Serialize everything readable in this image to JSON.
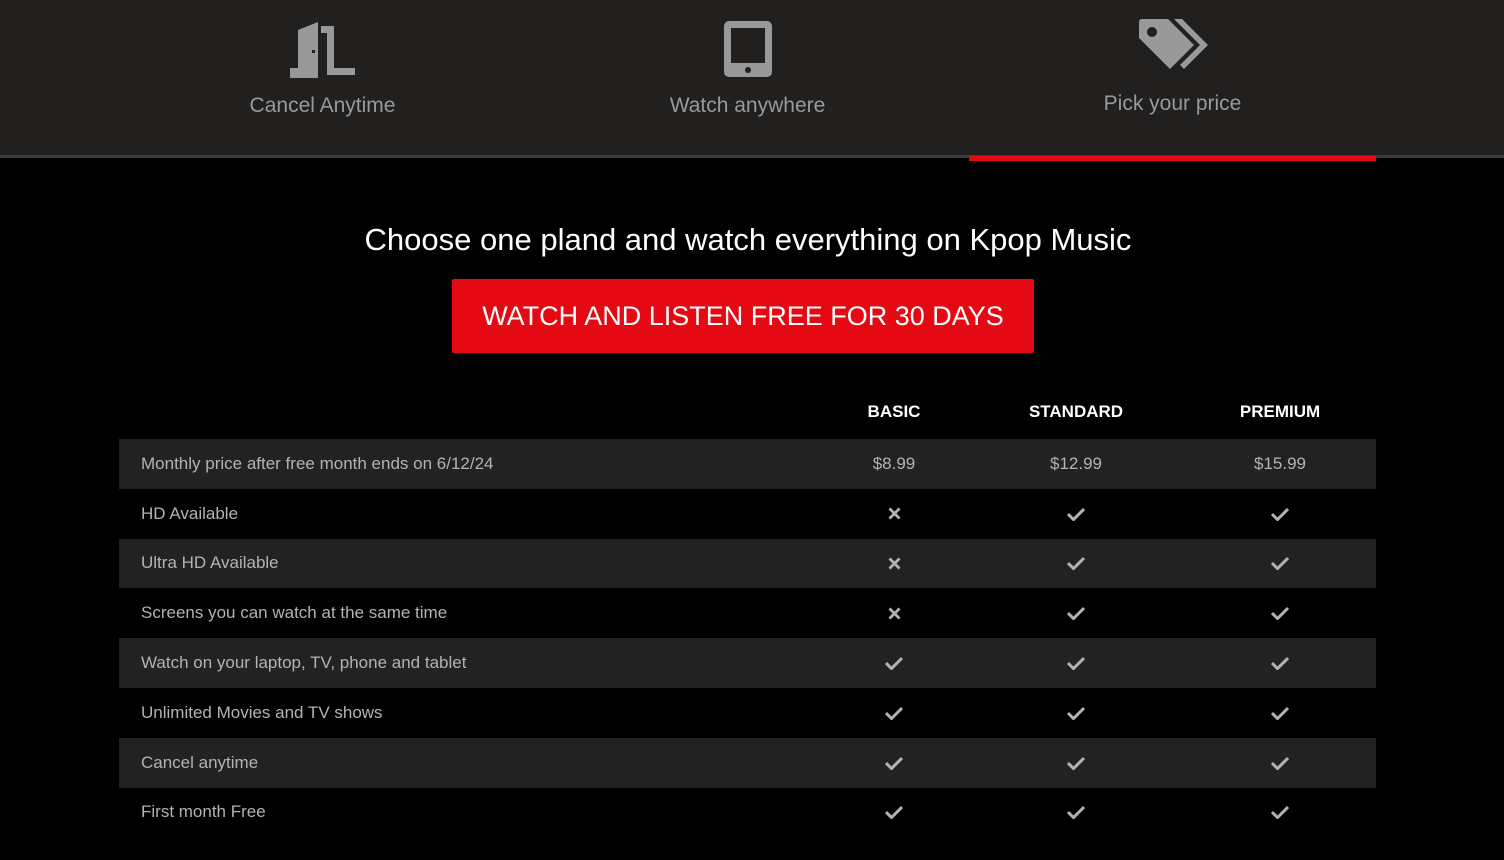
{
  "tabs": [
    {
      "label": "Cancel Anytime",
      "icon": "door-icon",
      "active": false
    },
    {
      "label": "Watch anywhere",
      "icon": "tablet-icon",
      "active": false
    },
    {
      "label": "Pick your price",
      "icon": "price-tags-icon",
      "active": true
    }
  ],
  "heading": "Choose one pland and watch everything on Kpop Music",
  "cta_label": "WATCH AND LISTEN FREE FOR 30 DAYS",
  "plans": [
    "BASIC",
    "STANDARD",
    "PREMIUM"
  ],
  "colors": {
    "accent": "#e50914",
    "tab_bg": "#221f1f",
    "row_shade": "#222222"
  },
  "rows": [
    {
      "feature": "Monthly price after free month ends on 6/12/24",
      "values": [
        "$8.99",
        "$12.99",
        "$15.99"
      ]
    },
    {
      "feature": "HD Available",
      "values": [
        "no",
        "yes",
        "yes"
      ]
    },
    {
      "feature": "Ultra HD Available",
      "values": [
        "no",
        "yes",
        "yes"
      ]
    },
    {
      "feature": "Screens you can watch at the same time",
      "values": [
        "no",
        "yes",
        "yes"
      ]
    },
    {
      "feature": "Watch on your laptop, TV, phone and tablet",
      "values": [
        "yes",
        "yes",
        "yes"
      ]
    },
    {
      "feature": "Unlimited Movies and TV shows",
      "values": [
        "yes",
        "yes",
        "yes"
      ]
    },
    {
      "feature": "Cancel anytime",
      "values": [
        "yes",
        "yes",
        "yes"
      ]
    },
    {
      "feature": "First month Free",
      "values": [
        "yes",
        "yes",
        "yes"
      ]
    }
  ]
}
